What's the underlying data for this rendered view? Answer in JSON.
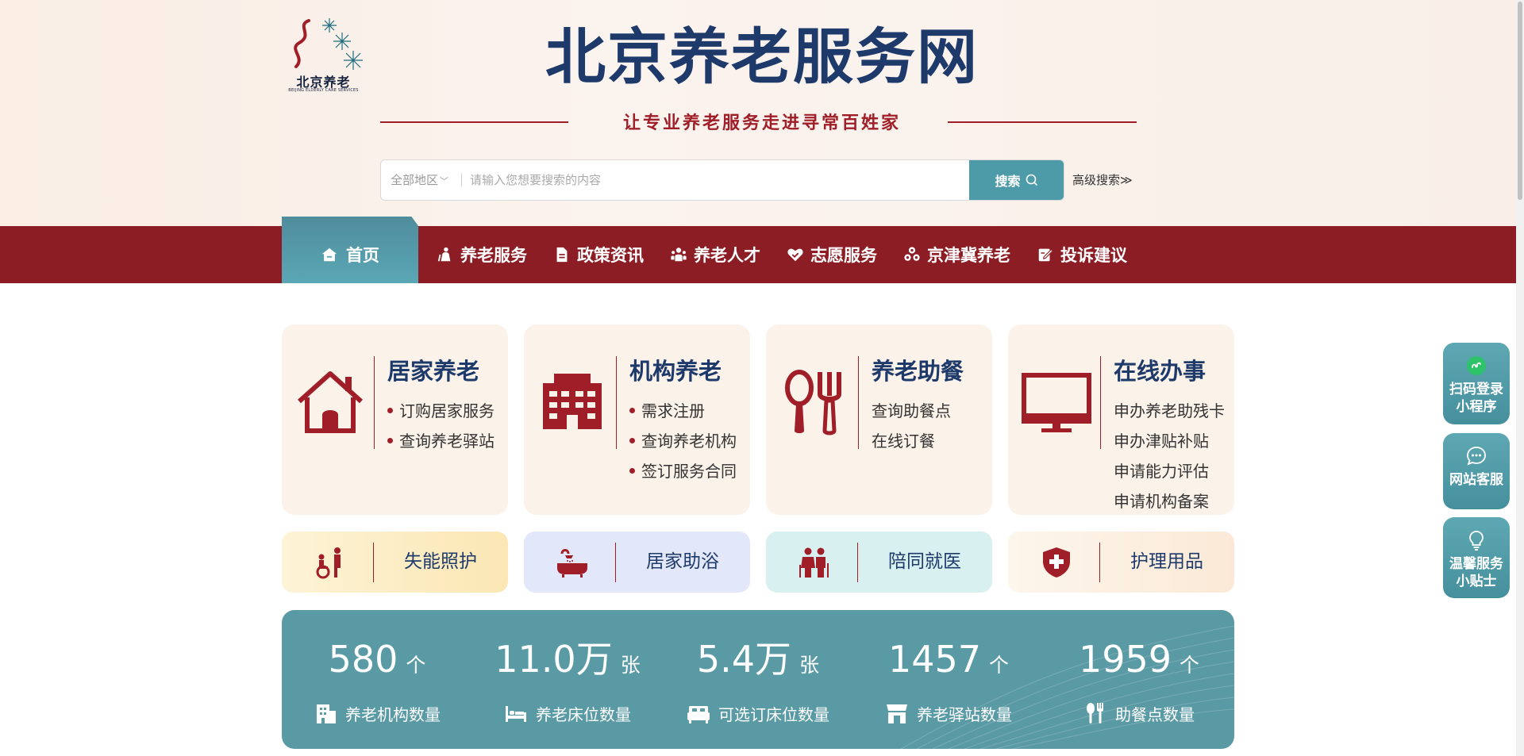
{
  "header": {
    "logo_text": "北京养老",
    "logo_sub": "BEIJING ELDERLY CARE SERVICES",
    "site_title": "北京养老服务网",
    "slogan": "让专业养老服务走进寻常百姓家"
  },
  "search": {
    "region": "全部地区",
    "placeholder": "请输入您想要搜索的内容",
    "button_label": "搜索",
    "advanced_label": "高级搜索≫"
  },
  "nav": {
    "home": "首页",
    "items": [
      {
        "label": "养老服务",
        "icon": "elder-icon"
      },
      {
        "label": "政策资讯",
        "icon": "document-icon"
      },
      {
        "label": "养老人才",
        "icon": "people-icon"
      },
      {
        "label": "志愿服务",
        "icon": "heart-hand-icon"
      },
      {
        "label": "京津冀养老",
        "icon": "cluster-icon"
      },
      {
        "label": "投诉建议",
        "icon": "edit-icon"
      }
    ]
  },
  "cards": [
    {
      "title": "居家养老",
      "icon": "house-icon",
      "items": [
        "订购居家服务",
        "查询养老驿站"
      ]
    },
    {
      "title": "机构养老",
      "icon": "building-icon",
      "items": [
        "需求注册",
        "查询养老机构",
        "签订服务合同"
      ]
    },
    {
      "title": "养老助餐",
      "icon": "spoon-fork-icon",
      "items": [
        "查询助餐点",
        "在线订餐"
      ]
    },
    {
      "title": "在线办事",
      "icon": "monitor-icon",
      "items": [
        "申办养老助残卡",
        "申办津贴补贴",
        "申请能力评估",
        "申请机构备案"
      ]
    }
  ],
  "small_cards": [
    {
      "label": "失能照护",
      "icon": "wheelchair-icon",
      "bg": "#fbeec4"
    },
    {
      "label": "居家助浴",
      "icon": "bathtub-icon",
      "bg": "#e2e8f9"
    },
    {
      "label": "陪同就医",
      "icon": "elderly-couple-icon",
      "bg": "#d8f0f0"
    },
    {
      "label": "护理用品",
      "icon": "medical-shield-icon",
      "bg": "#fbefe1"
    }
  ],
  "stats": [
    {
      "value": "580",
      "unit": "个",
      "label": "养老机构数量",
      "icon": "institution-icon"
    },
    {
      "value": "11.0万",
      "unit": "张",
      "label": "养老床位数量",
      "icon": "bed-icon"
    },
    {
      "value": "5.4万",
      "unit": "张",
      "label": "可选订床位数量",
      "icon": "bed-alt-icon"
    },
    {
      "value": "1457",
      "unit": "个",
      "label": "养老驿站数量",
      "icon": "station-icon"
    },
    {
      "value": "1959",
      "unit": "个",
      "label": "助餐点数量",
      "icon": "utensils-icon"
    }
  ],
  "side_float": [
    {
      "label": "扫码登录小程序",
      "line1": "扫码登录",
      "line2": "小程序",
      "icon": "miniprogram-icon"
    },
    {
      "label": "网站客服",
      "line1": "网站客服",
      "line2": "",
      "icon": "chat-icon"
    },
    {
      "label": "温馨服务小贴士",
      "line1": "温馨服务",
      "line2": "小贴士",
      "icon": "lightbulb-icon"
    }
  ],
  "colors": {
    "brand_red": "#8c1d24",
    "accent_red": "#a01e28",
    "teal": "#5a9aa5",
    "navy": "#1e3a6b"
  }
}
